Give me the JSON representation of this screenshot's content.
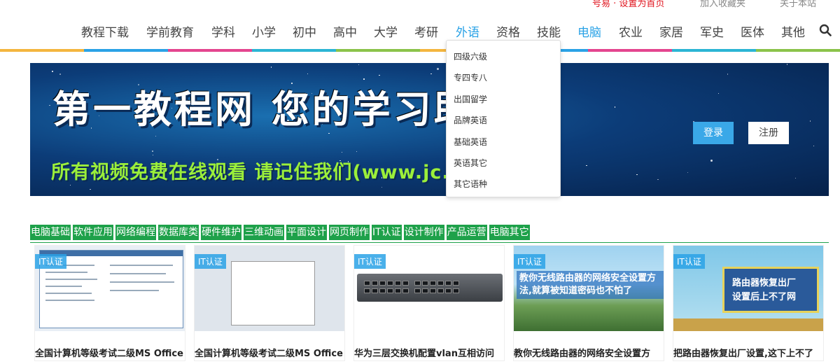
{
  "top_links": {
    "red": "号易 · 设置为首页",
    "gray1": "加入收藏夹",
    "gray2": "关于本站"
  },
  "nav": {
    "items": [
      "教程下载",
      "学前教育",
      "学科",
      "小学",
      "初中",
      "高中",
      "大学",
      "考研",
      "外语",
      "资格",
      "技能",
      "电脑",
      "农业",
      "家居",
      "军史",
      "医体",
      "其他"
    ],
    "active_hover": "外语",
    "active_current": "电脑",
    "search_icon": "search-icon"
  },
  "color_bar": [
    "#f4b63f",
    "#2aa2e6",
    "#e4458f",
    "#2bb5d4",
    "#8bc34a",
    "#f4b63f",
    "#2aa2e6",
    "#e4458f",
    "#2bb5d4",
    "#8bc34a"
  ],
  "banner": {
    "title": "第一教程网   您的学习助手",
    "subtitle": "所有视频免费在线观看     请记住我们(www.jc.com)",
    "login": "登录",
    "register": "注册"
  },
  "dropdown": [
    "四级六级",
    "专四专八",
    "出国留学",
    "品牌英语",
    "基础英语",
    "英语其它",
    "其它语种"
  ],
  "categories": [
    "电脑基础",
    "软件应用",
    "网络编程",
    "数据库类",
    "硬件维护",
    "三维动画",
    "平面设计",
    "网页制作",
    "IT认证",
    "设计制作",
    "产品运营",
    "电脑其它"
  ],
  "cards": [
    {
      "badge": "IT认证",
      "title": "全国计算机等级考试二级MS Office"
    },
    {
      "badge": "IT认证",
      "title": "全国计算机等级考试二级MS Office"
    },
    {
      "badge": "IT认证",
      "title": "华为三层交换机配置vlan互相访问"
    },
    {
      "badge": "IT认证",
      "title": "教你无线路由器的网络安全设置方",
      "caption": "教你无线路由器的网络安全设置方法,就算被知道密码也不怕了"
    },
    {
      "badge": "IT认证",
      "title": "把路由器恢复出厂设置,这下上不了",
      "caption1": "路由器恢复出厂",
      "caption2": "设置后上不了网"
    }
  ],
  "colors": {
    "accent": "#2aa2e6",
    "green": "#1ea14a",
    "red": "#e0141e"
  }
}
